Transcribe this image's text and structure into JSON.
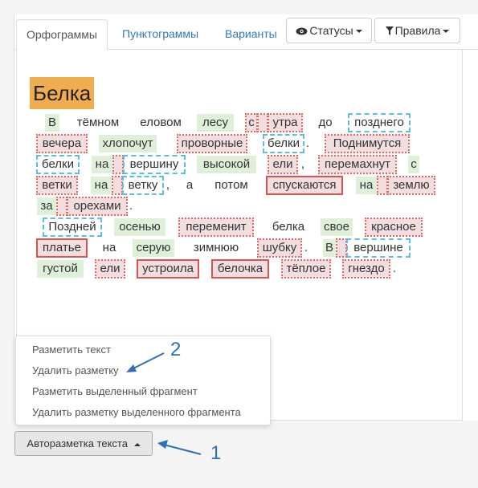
{
  "tabs": [
    {
      "label": "Орфограммы"
    },
    {
      "label": "Пунктограммы"
    },
    {
      "label": "Варианты"
    }
  ],
  "dropdowns": {
    "statuses": {
      "label": "Статусы",
      "icon": "eye-icon"
    },
    "rules": {
      "label": "Правила",
      "icon": "filter-icon"
    }
  },
  "text": {
    "title": "Белка",
    "words": [
      "В",
      "тёмном",
      "еловом",
      "лесу",
      "с",
      "утра",
      "до",
      "позднего",
      "вечера",
      "хлопочут",
      "проворные",
      "белки",
      ".",
      "Поднимутся",
      "белки",
      "на",
      "вершину",
      "высокой",
      "ели",
      ",",
      "перемахнут",
      "с",
      "ветки",
      "на",
      "ветку",
      ",",
      "а",
      "потом",
      "спускаются",
      "на",
      "землю",
      "за",
      "орехами",
      ".",
      "Поздней",
      "осенью",
      "переменит",
      "белка",
      "свое",
      "красное",
      "платье",
      "на",
      "серую",
      "зимнюю",
      "шубку",
      ".",
      "В",
      "вершине",
      "густой",
      "ели",
      "устроила",
      "белочка",
      "тёплое",
      "гнездо",
      "."
    ]
  },
  "menu": {
    "items": [
      "Разметить текст",
      "Удалить разметку",
      "Разметить выделенный фрагмент",
      "Удалить разметку выделенного фрагмента"
    ]
  },
  "auto_button": {
    "label": "Авторазметка текста"
  },
  "annotations": {
    "one": "1",
    "two": "2",
    "color": "#2f6fb5"
  },
  "colors": {
    "title_bg": "#f0ad4e",
    "green": "#dff0d8",
    "red_fill": "#f2dede",
    "red_dotted": "#e06666",
    "blue_dashed": "#5bc0de",
    "red_solid": "#d9534f"
  }
}
